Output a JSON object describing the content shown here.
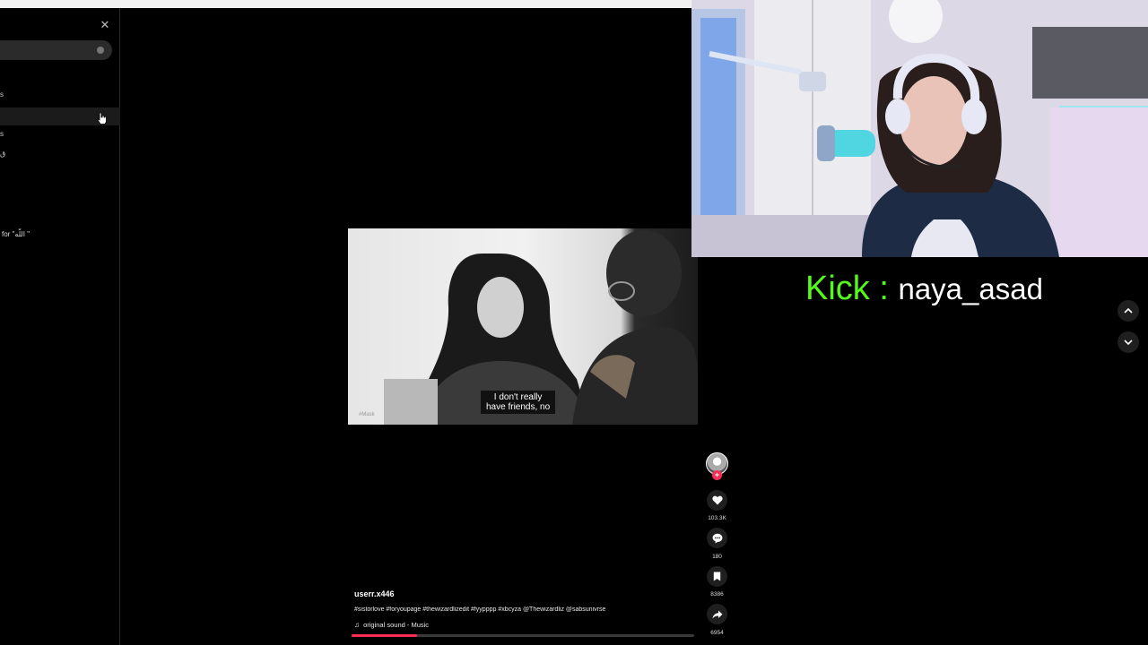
{
  "sidebar": {
    "close_icon": "close-icon",
    "rows": [
      "s",
      "",
      "s",
      "ق"
    ],
    "search_for_text": "for \"اللّه \""
  },
  "video": {
    "caption_line1": "I don't really",
    "caption_line2": "have friends, no",
    "watermark": "#Mask"
  },
  "post": {
    "username": "userr.x446",
    "hashtags": "#sistorlove #foryoupage #thewizardlizedit #fyypppp #xbcyza @Thewizardliz @sabsunivrse",
    "sound": "original sound - Music",
    "progress_percent": 19
  },
  "actions": {
    "likes": "103.3K",
    "comments": "180",
    "saves": "8386",
    "shares": "6954"
  },
  "overlay": {
    "kick_label": "Kick :",
    "kick_name": "naya_asad"
  },
  "colors": {
    "accent": "#fe2c55",
    "kick_green": "#53fc18"
  }
}
